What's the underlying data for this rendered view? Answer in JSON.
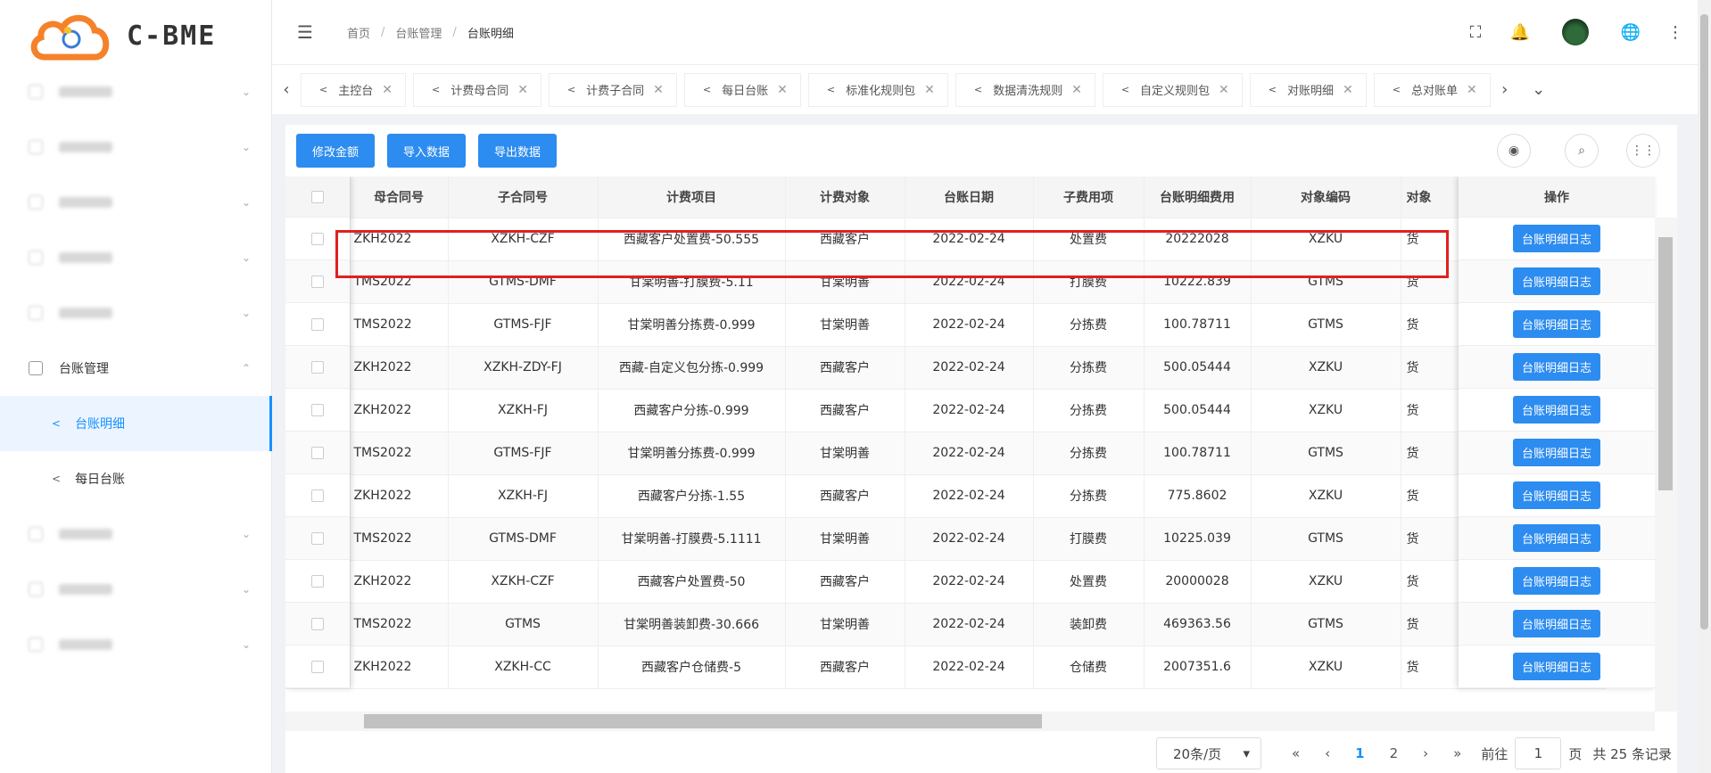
{
  "logo": {
    "text": "C-BME"
  },
  "sidebar": {
    "items": [
      {
        "label": "",
        "blurred": true
      },
      {
        "label": "",
        "blurred": true
      },
      {
        "label": "",
        "blurred": true
      },
      {
        "label": "",
        "blurred": true
      },
      {
        "label": "",
        "blurred": true
      },
      {
        "label": "台账管理",
        "blurred": false,
        "expanded": true
      },
      {
        "label": "",
        "blurred": true
      },
      {
        "label": "",
        "blurred": true
      },
      {
        "label": "",
        "blurred": true
      }
    ],
    "sub_items": [
      {
        "label": "台账明细",
        "active": true
      },
      {
        "label": "每日台账",
        "active": false
      }
    ]
  },
  "breadcrumb": {
    "home": "首页",
    "parent": "台账管理",
    "current": "台账明细"
  },
  "tabs": [
    "主控台",
    "计费母合同",
    "计费子合同",
    "每日台账",
    "标准化规则包",
    "数据清洗规则",
    "自定义规则包",
    "对账明细",
    "总对账单"
  ],
  "toolbar": {
    "edit_amount": "修改金额",
    "import": "导入数据",
    "export": "导出数据"
  },
  "table": {
    "headers": [
      "母合同号",
      "子合同号",
      "计费项目",
      "计费对象",
      "台账日期",
      "子费用项",
      "台账明细费用",
      "对象编码",
      "对象"
    ],
    "action_header": "操作",
    "action_label": "台账明细日志",
    "rows": [
      [
        "ZKH2022",
        "XZKH-CZF",
        "西藏客户处置费-50.555",
        "西藏客户",
        "2022-02-24",
        "处置费",
        "20222028",
        "XZKU",
        "货"
      ],
      [
        "TMS2022",
        "GTMS-DMF",
        "甘棠明善-打膜费-5.11",
        "甘棠明善",
        "2022-02-24",
        "打膜费",
        "10222.839",
        "GTMS",
        "货"
      ],
      [
        "TMS2022",
        "GTMS-FJF",
        "甘棠明善分拣费-0.999",
        "甘棠明善",
        "2022-02-24",
        "分拣费",
        "100.78711",
        "GTMS",
        "货"
      ],
      [
        "ZKH2022",
        "XZKH-ZDY-FJ",
        "西藏-自定义包分拣-0.999",
        "西藏客户",
        "2022-02-24",
        "分拣费",
        "500.05444",
        "XZKU",
        "货"
      ],
      [
        "ZKH2022",
        "XZKH-FJ",
        "西藏客户分拣-0.999",
        "西藏客户",
        "2022-02-24",
        "分拣费",
        "500.05444",
        "XZKU",
        "货"
      ],
      [
        "TMS2022",
        "GTMS-FJF",
        "甘棠明善分拣费-0.999",
        "甘棠明善",
        "2022-02-24",
        "分拣费",
        "100.78711",
        "GTMS",
        "货"
      ],
      [
        "ZKH2022",
        "XZKH-FJ",
        "西藏客户分拣-1.55",
        "西藏客户",
        "2022-02-24",
        "分拣费",
        "775.8602",
        "XZKU",
        "货"
      ],
      [
        "TMS2022",
        "GTMS-DMF",
        "甘棠明善-打膜费-5.1111",
        "甘棠明善",
        "2022-02-24",
        "打膜费",
        "10225.039",
        "GTMS",
        "货"
      ],
      [
        "ZKH2022",
        "XZKH-CZF",
        "西藏客户处置费-50",
        "西藏客户",
        "2022-02-24",
        "处置费",
        "20000028",
        "XZKU",
        "货"
      ],
      [
        "TMS2022",
        "GTMS",
        "甘棠明善装卸费-30.666",
        "甘棠明善",
        "2022-02-24",
        "装卸费",
        "469363.56",
        "GTMS",
        "货"
      ],
      [
        "ZKH2022",
        "XZKH-CC",
        "西藏客户仓储费-5",
        "西藏客户",
        "2022-02-24",
        "仓储费",
        "2007351.6",
        "XZKU",
        "货"
      ]
    ]
  },
  "pager": {
    "page_size": "20条/页",
    "pages": [
      "1",
      "2"
    ],
    "current": "1",
    "goto_prefix": "前往",
    "goto_value": "1",
    "goto_suffix": "页",
    "total": "共 25 条记录"
  },
  "colors": {
    "primary": "#2d8cf0",
    "highlight": "#e02020"
  }
}
